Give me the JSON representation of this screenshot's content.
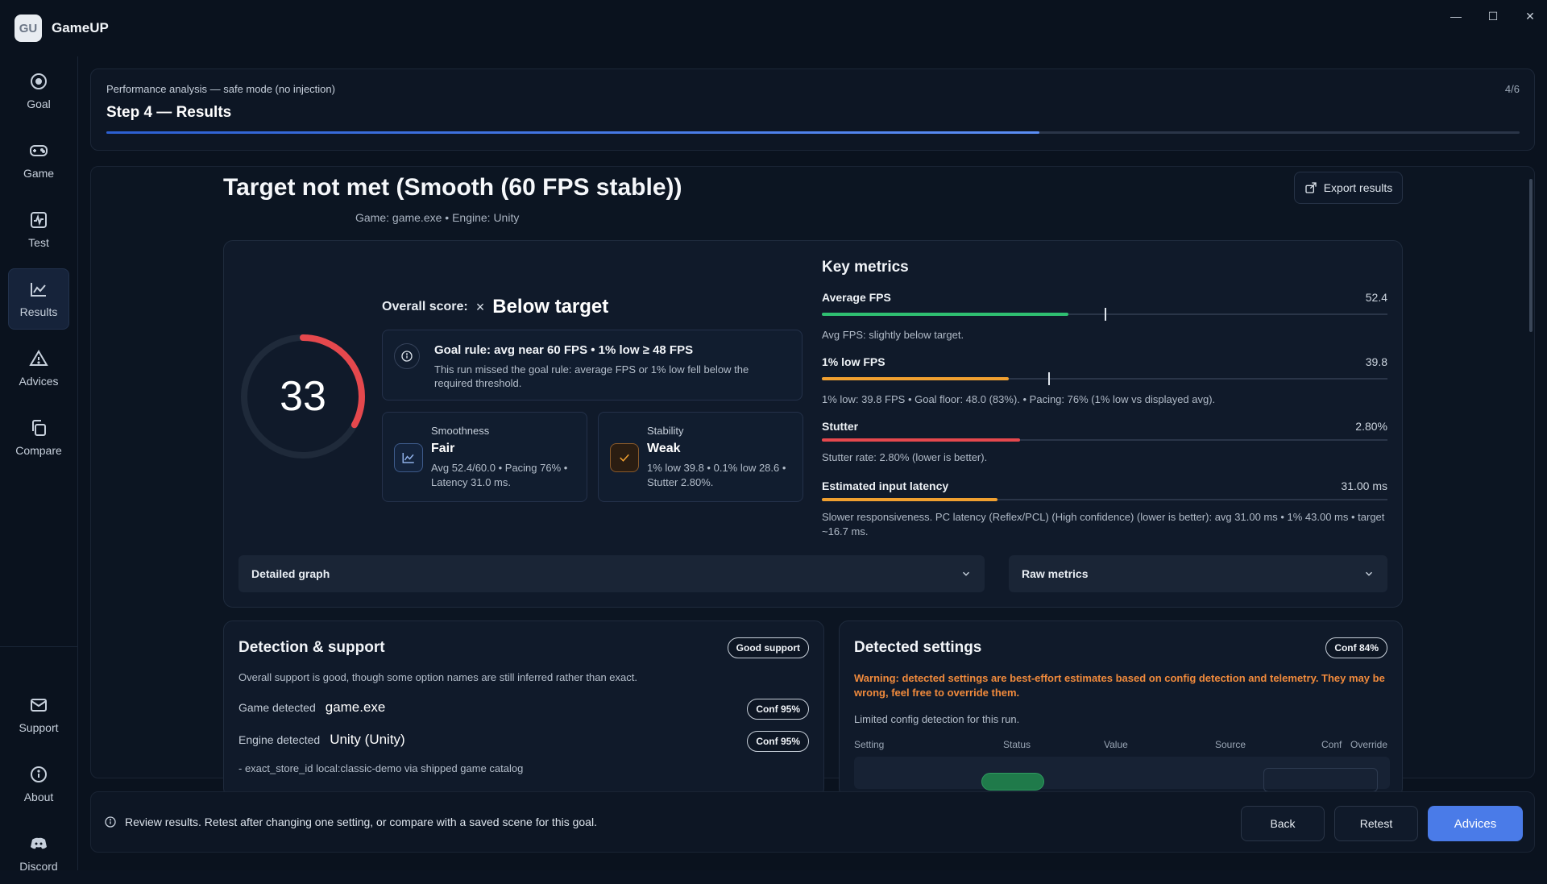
{
  "app": {
    "logo_text": "GU",
    "name": "GameUP"
  },
  "window_controls": {
    "minimize": "—",
    "maximize": "☐",
    "close": "✕"
  },
  "sidebar": {
    "items": [
      {
        "label": "Goal",
        "icon": "target-icon"
      },
      {
        "label": "Game",
        "icon": "gamepad-icon"
      },
      {
        "label": "Test",
        "icon": "pulse-icon"
      },
      {
        "label": "Results",
        "icon": "chart-icon",
        "active": true
      },
      {
        "label": "Advices",
        "icon": "warning-icon"
      },
      {
        "label": "Compare",
        "icon": "copy-icon"
      }
    ],
    "bottom_items": [
      {
        "label": "Support",
        "icon": "mail-icon"
      },
      {
        "label": "About",
        "icon": "info-icon"
      },
      {
        "label": "Discord",
        "icon": "discord-icon"
      }
    ]
  },
  "step": {
    "subtitle": "Performance analysis — safe mode (no injection)",
    "title": "Step 4 — Results",
    "counter": "4/6",
    "progress": 0.66
  },
  "header": {
    "title": "Target not met (Smooth (60 FPS stable))",
    "subtitle": "Game: game.exe • Engine: Unity",
    "export_label": "Export results"
  },
  "score": {
    "value": "33",
    "fraction": 0.33,
    "label": "Overall score:",
    "status_icon": "×",
    "status": "Below target"
  },
  "goal_rule": {
    "title": "Goal rule: avg near 60 FPS • 1% low ≥ 48 FPS",
    "desc": "This run missed the goal rule: average FPS or 1% low fell below the required threshold."
  },
  "smoothness": {
    "label": "Smoothness",
    "value": "Fair",
    "desc": "Avg 52.4/60.0 • Pacing 76% • Latency 31.0 ms."
  },
  "stability": {
    "label": "Stability",
    "value": "Weak",
    "desc": "1% low 39.8 • 0.1% low 28.6 • Stutter 2.80%."
  },
  "key_metrics": {
    "title": "Key metrics",
    "items": [
      {
        "name": "Average FPS",
        "value": "52.4",
        "desc": "Avg FPS: slightly below target.",
        "fill": 0.436,
        "marker": 0.5,
        "color": "#2fbf71"
      },
      {
        "name": "1% low FPS",
        "value": "39.8",
        "desc": "1% low: 39.8 FPS • Goal floor: 48.0 (83%). • Pacing: 76% (1% low vs displayed avg).",
        "fill": 0.331,
        "marker": 0.4,
        "color": "#f0a030"
      },
      {
        "name": "Stutter",
        "value": "2.80%",
        "desc": "Stutter rate: 2.80% (lower is better).",
        "fill": 0.35,
        "color": "#e5484d"
      },
      {
        "name": "Estimated input latency",
        "value": "31.00 ms",
        "desc": "Slower responsiveness. PC latency (Reflex/PCL) (High confidence) (lower is better): avg 31.00 ms • 1% 43.00 ms • target ~16.7 ms.",
        "fill": 0.31,
        "color": "#f0a030"
      }
    ]
  },
  "collapsibles": {
    "graph": "Detailed graph",
    "raw": "Raw metrics"
  },
  "detection": {
    "title": "Detection & support",
    "badge": "Good support",
    "summary": "Overall support is good, though some option names are still inferred rather than exact.",
    "game_label": "Game detected",
    "game_value": "game.exe",
    "game_conf": "Conf 95%",
    "engine_label": "Engine detected",
    "engine_value": "Unity (Unity)",
    "engine_conf": "Conf 95%",
    "store_line": "- exact_store_id local:classic-demo via shipped game catalog"
  },
  "settings": {
    "title": "Detected settings",
    "badge": "Conf 84%",
    "warning": "Warning: detected settings are best-effort estimates based on config detection and telemetry. They may be wrong, feel free to override them.",
    "limited": "Limited config detection for this run.",
    "columns": [
      "Setting",
      "Status",
      "Value",
      "Source",
      "Conf",
      "Override"
    ]
  },
  "footer": {
    "info": "Review results. Retest after changing one setting, or compare with a saved scene for this goal.",
    "back": "Back",
    "retest": "Retest",
    "advices": "Advices"
  },
  "colors": {
    "accent": "#4a7be8",
    "bad": "#e5484d",
    "warn": "#f0a030",
    "good": "#2fbf71"
  }
}
